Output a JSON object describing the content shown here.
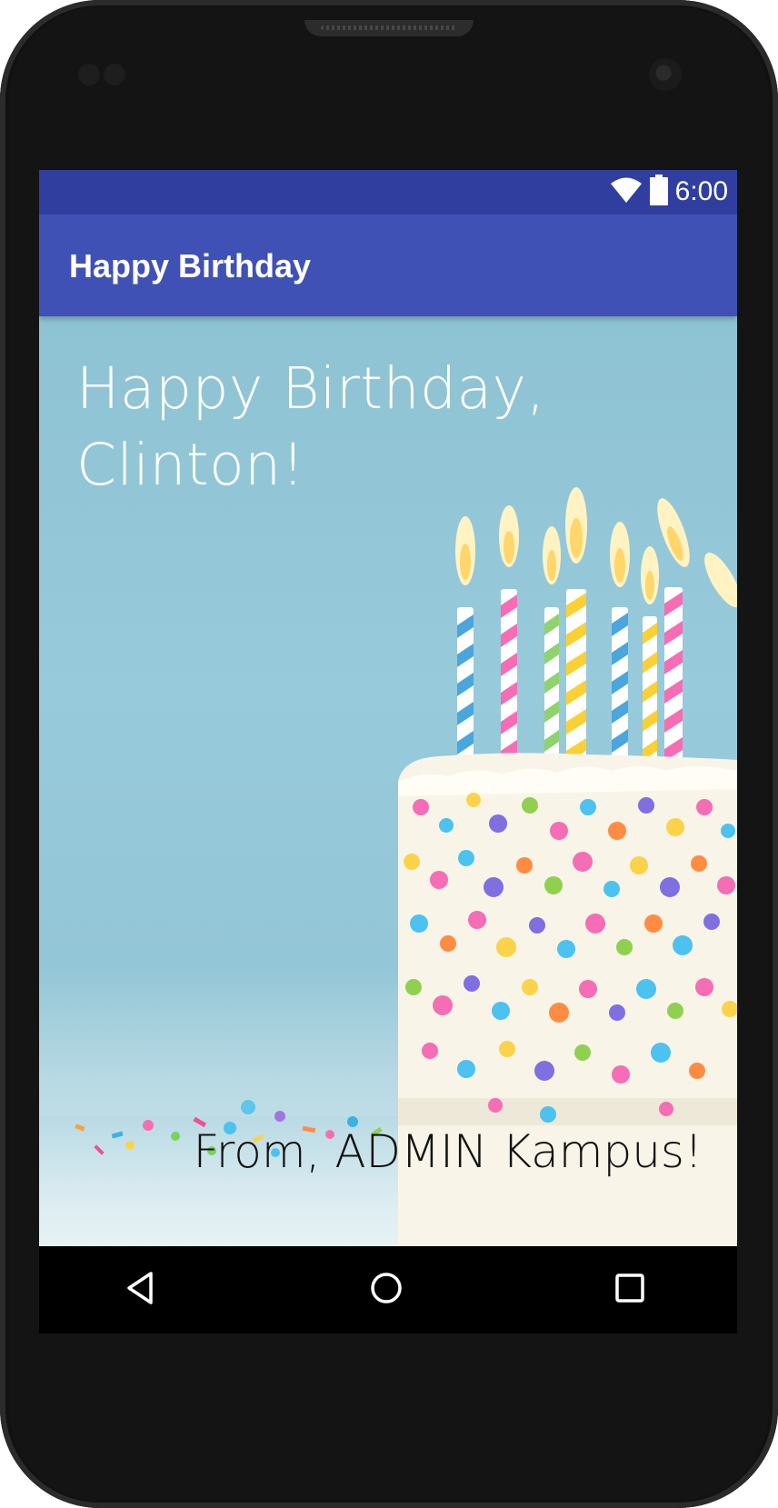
{
  "status_bar": {
    "time": "6:00",
    "icons": [
      "wifi-icon",
      "battery-icon"
    ],
    "color": "#303f9f"
  },
  "app_bar": {
    "title": "Happy Birthday",
    "color": "#3f51b5"
  },
  "content": {
    "greeting": "Happy Birthday, Clinton!",
    "signature": "From, ADMIN Kampus!",
    "background_image": "birthday-cake-with-candles-image"
  },
  "nav_bar": {
    "buttons": [
      "back-icon",
      "home-icon",
      "recents-icon"
    ]
  }
}
